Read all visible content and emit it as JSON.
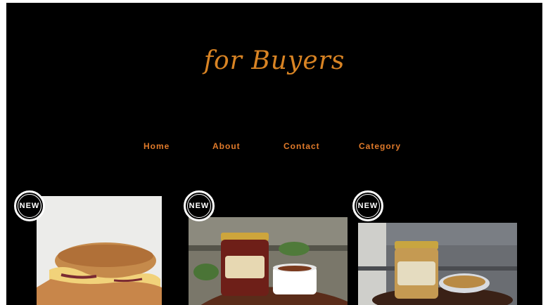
{
  "header": {
    "title": "for Buyers"
  },
  "nav": {
    "items": [
      {
        "label": "Home"
      },
      {
        "label": "About"
      },
      {
        "label": "Contact"
      },
      {
        "label": "Category"
      }
    ]
  },
  "products": {
    "badge_label": "NEW",
    "items": [
      {
        "image": "grilled-cheese-sandwich"
      },
      {
        "image": "jar-of-preserves-on-board"
      },
      {
        "image": "jar-of-mustard-with-seeds"
      }
    ]
  },
  "colors": {
    "background": "#000000",
    "title": "#d98424",
    "nav": "#e07a2a",
    "badge": "#ffffff"
  }
}
